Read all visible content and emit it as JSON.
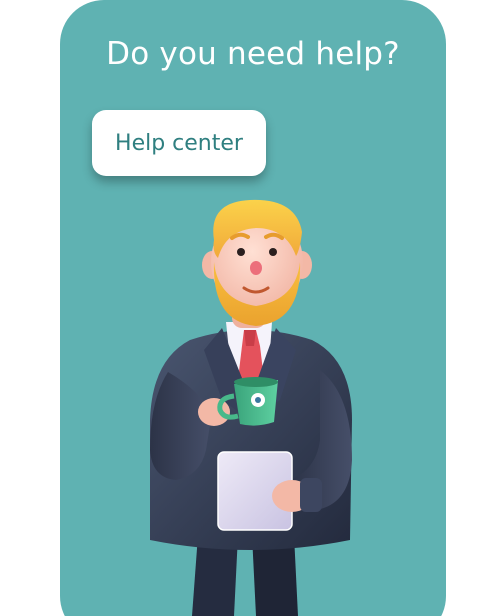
{
  "card": {
    "title": "Do you need help?",
    "button_label": "Help center"
  },
  "colors": {
    "card_background": "#5fb2b2",
    "button_text": "#2f7f80",
    "title_text": "#ffffff"
  },
  "illustration": {
    "icon": "businessman-with-coffee-and-tablet"
  }
}
